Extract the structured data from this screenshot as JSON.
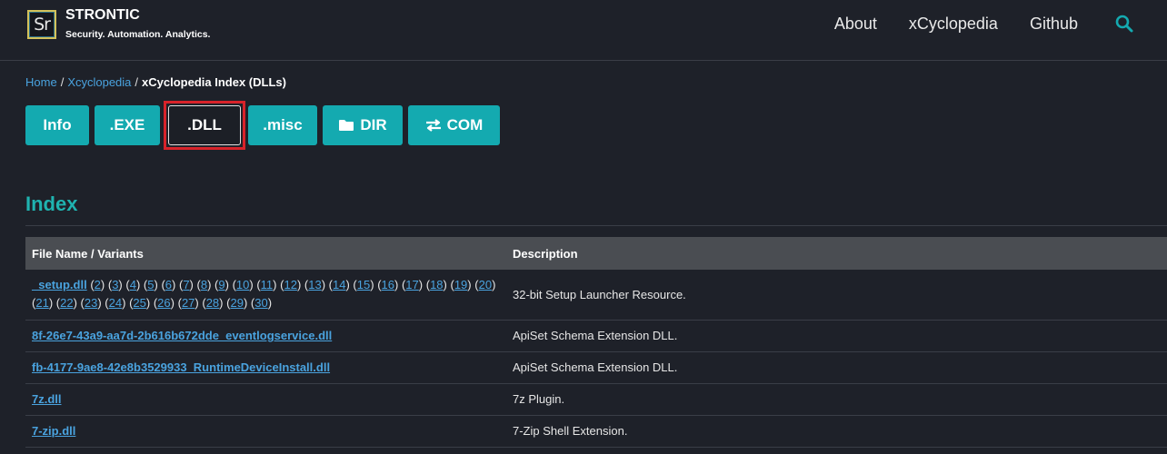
{
  "brand": {
    "logo_text": "Sr",
    "name": "STRONTIC",
    "tagline": "Security. Automation. Analytics."
  },
  "nav": {
    "items": [
      "About",
      "xCyclopedia",
      "Github"
    ],
    "search_icon": "search-icon",
    "accent": "#14aab0"
  },
  "breadcrumb": {
    "home": "Home",
    "xcyclopedia": "Xcyclopedia",
    "separator": "/",
    "current": "xCyclopedia Index (DLLs)"
  },
  "buttons": {
    "info": "Info",
    "exe": ".EXE",
    "dll": ".DLL",
    "misc": ".misc",
    "dir": "DIR",
    "com": "COM",
    "dir_icon": "folder-icon",
    "com_icon": "exchange-arrows-icon",
    "selected": ".DLL",
    "highlight_color": "#d8232a"
  },
  "index": {
    "title": "Index",
    "columns": {
      "file": "File Name / Variants",
      "description": "Description"
    },
    "rows": [
      {
        "file": "_setup.dll",
        "variants_line1": [
          "2",
          "3",
          "4",
          "5",
          "6",
          "7",
          "8",
          "9",
          "10",
          "11",
          "12",
          "13",
          "14",
          "15",
          "16",
          "17",
          "18",
          "19",
          "20"
        ],
        "variants_line2": [
          "21",
          "22",
          "23",
          "24",
          "25",
          "26",
          "27",
          "28",
          "29",
          "30"
        ],
        "description": "32-bit Setup Launcher Resource."
      },
      {
        "file": "8f-26e7-43a9-aa7d-2b616b672dde_eventlogservice.dll",
        "description": "ApiSet Schema Extension DLL."
      },
      {
        "file": "fb-4177-9ae8-42e8b3529933_RuntimeDeviceInstall.dll",
        "description": "ApiSet Schema Extension DLL."
      },
      {
        "file": "7z.dll",
        "description": "7z Plugin."
      },
      {
        "file": "7-zip.dll",
        "description": "7-Zip Shell Extension."
      }
    ]
  }
}
